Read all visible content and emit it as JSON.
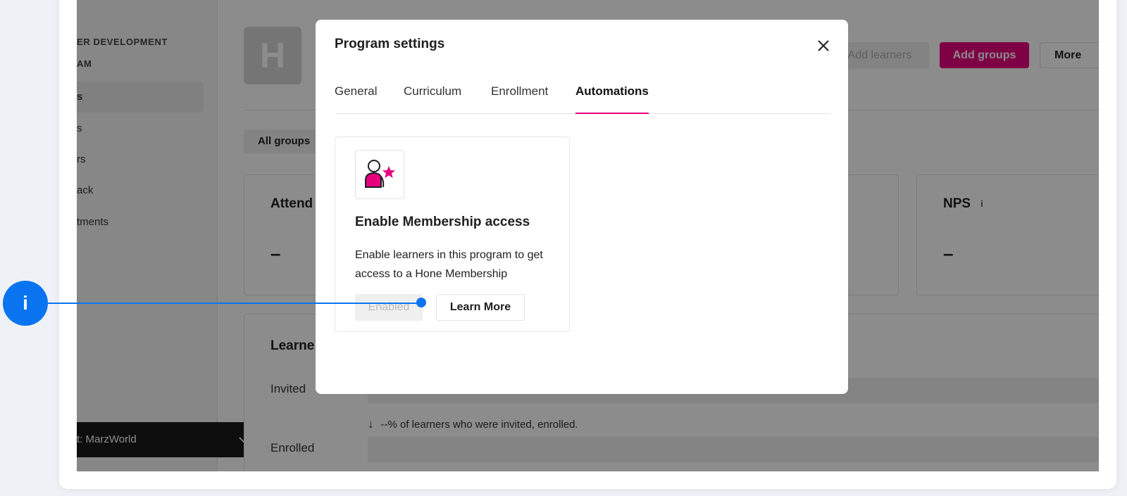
{
  "sidebar": {
    "program_label_line1": "ER DEVELOPMENT",
    "program_label_line2": "AM",
    "items": [
      {
        "label": "s",
        "active": true
      },
      {
        "label": "s"
      },
      {
        "label": "rs"
      },
      {
        "label": "ack"
      },
      {
        "label": "tments"
      }
    ],
    "account_label": "t: MarzWorld",
    "account_chevron": "chevron-down-icon"
  },
  "header": {
    "logo_letter": "H",
    "add_learners_label": "Add learners",
    "add_groups_label": "Add groups",
    "more_label": "More"
  },
  "filters": {
    "all_groups_label": "All groups"
  },
  "stats": [
    {
      "title": "Attend",
      "value": "–"
    },
    {
      "title": "NPS",
      "value": "–",
      "info": "i"
    }
  ],
  "learners": {
    "title": "Learne",
    "rows": [
      {
        "label": "Invited"
      },
      {
        "label": "Enrolled"
      }
    ],
    "note": "--% of learners who were invited, enrolled.",
    "note_icon": "arrow-down-icon"
  },
  "modal": {
    "title": "Program settings",
    "close_icon": "close-icon",
    "tabs": [
      {
        "label": "General",
        "active": false
      },
      {
        "label": "Curriculum",
        "active": false
      },
      {
        "label": "Enrollment",
        "active": false
      },
      {
        "label": "Automations",
        "active": true
      }
    ],
    "automation": {
      "icon": "membership-star-icon",
      "title": "Enable Membership access",
      "description": "Enable learners in this program to get access to a Hone Membership",
      "enabled_label": "Enabled",
      "learn_more_label": "Learn More"
    }
  },
  "annotation": {
    "marker_label": "i"
  },
  "colors": {
    "accent": "#e6007e",
    "annotation": "#0a74f0",
    "overlay": "rgba(0,0,0,0.45)"
  }
}
